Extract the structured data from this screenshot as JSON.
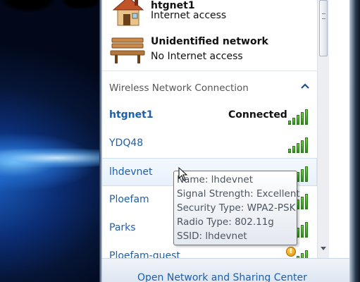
{
  "networks": [
    {
      "name": "htgnet1",
      "status": "Internet access",
      "icon": "house-icon"
    },
    {
      "name": "Unidentified network",
      "status": "No Internet access",
      "icon": "park-bench-icon"
    }
  ],
  "wireless_section": {
    "title": "Wireless Network Connection",
    "collapse_icon": "chevron-up-icon"
  },
  "wifi_list": [
    {
      "name": "htgnet1",
      "state": "Connected",
      "signal_bars": 5
    },
    {
      "name": "YDQ48",
      "state": "",
      "signal_bars": 5
    },
    {
      "name": "lhdevnet",
      "state": "",
      "signal_bars": 5
    },
    {
      "name": "Ploefam",
      "state": "",
      "signal_bars": 5
    },
    {
      "name": "Parks",
      "state": "",
      "signal_bars": 5
    },
    {
      "name": "Ploefam-guest",
      "state": "",
      "signal_bars": 5,
      "security_warning": true
    }
  ],
  "tooltip": {
    "name": "Name: lhdevnet",
    "signal": "Signal Strength: Excellent",
    "security": "Security Type: WPA2-PSK",
    "radio": "Radio Type: 802.11g",
    "ssid": "SSID: lhdevnet"
  },
  "footer": {
    "link": "Open Network and Sharing Center"
  },
  "colors": {
    "link_blue": "#1f5fa8",
    "signal_green": "#3fa52a",
    "warning_orange": "#e08a00"
  }
}
